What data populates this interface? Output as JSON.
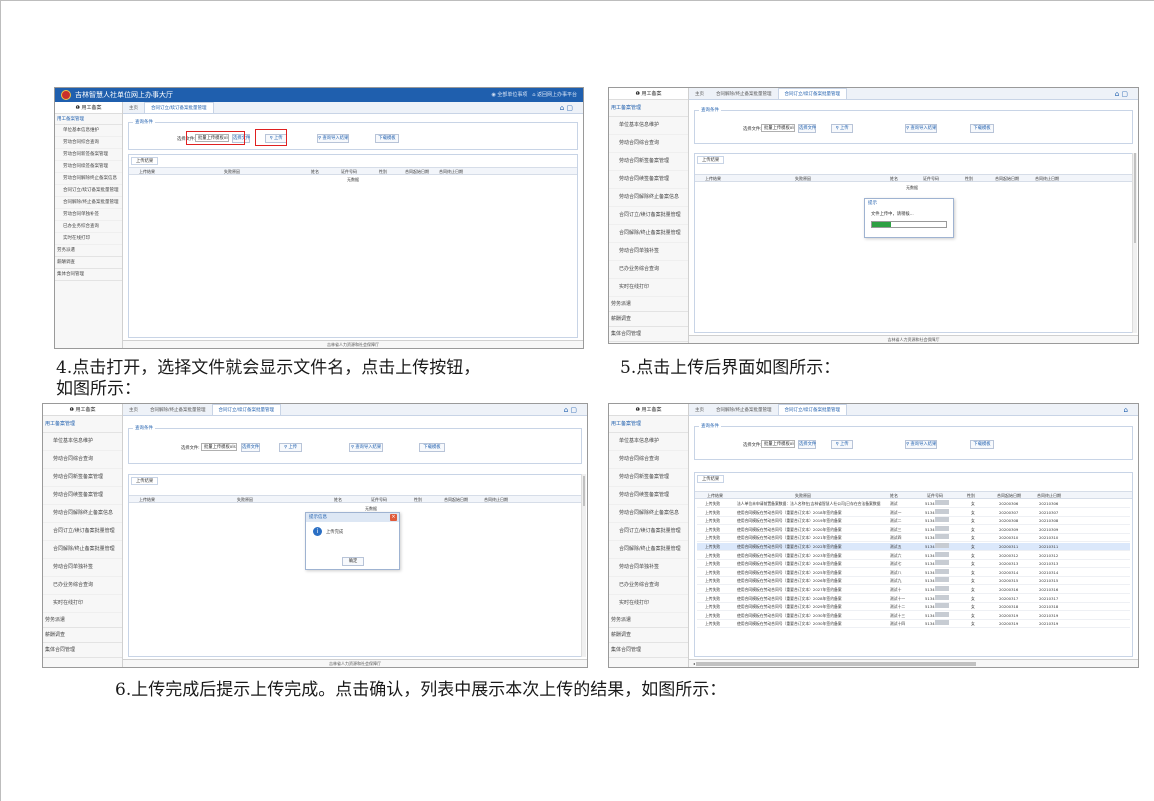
{
  "captions": {
    "step4_line1": "4.点击打开，选择文件就会显示文件名，点击上传按钮，",
    "step4_line2": "如图所示：",
    "step5": "5.点击上传后界面如图所示：",
    "step6": "6.上传完成后提示上传完成。点击确认，列表中展示本次上传的结果，如图所示："
  },
  "app": {
    "title": "吉林智慧人社单位网上办事大厅",
    "top_right_user": "全部单位事项",
    "top_right_home": "返回网上办事平台",
    "side_head": "用工备案",
    "footer": "吉林省人力资源和社会保障厅"
  },
  "sidebar": {
    "group_open": "用工备案管理",
    "items": [
      "单位基本信息维护",
      "劳动合同综合查询",
      "劳动合同新签备案管理",
      "劳动合同续签备案管理",
      "劳动合同解除终止备案信息",
      "合同订立/续订备案批量管理",
      "合同解除/终止备案批量管理",
      "劳动合同单独补签",
      "已办业务综合查询",
      "实时在线打印"
    ],
    "tails": [
      "劳务派遣",
      "薪酬调查",
      "集体合同管理"
    ]
  },
  "tabs": [
    "主页",
    "合同解除/终止备案批量管理",
    "合同订立/续订备案批量管理"
  ],
  "conditions": {
    "label": "查询条件",
    "file_label": "选择文件:",
    "file_value": "批量上传模板xls.xls",
    "choose_button": "选择文件",
    "upload_button": "上传",
    "view_result_button": "查询导入结果",
    "download_template_button": "下载模板"
  },
  "results": {
    "tab": "上传结果",
    "columns": [
      "上传结果",
      "失败原因",
      "姓名",
      "证件号码",
      "性别",
      "合同起始日期",
      "合同终止日期"
    ],
    "no_data": "无数据"
  },
  "progress_dialog": {
    "title": "提示",
    "message": "文件上传中，请稍候...",
    "percent": 0.25
  },
  "done_dialog": {
    "title": "提示信息",
    "message": "上传完成",
    "ok_button": "确定"
  },
  "upload_rows": [
    {
      "result": "上传失败",
      "reason": "法人单位未申请前置备案数据：法人名称在[吉林省智慧人社公司]已存在合法备案数据",
      "name": "测试",
      "id": "5134",
      "gender": "女",
      "start": "20200306",
      "end": "20210306"
    },
    {
      "result": "上传失败",
      "reason": "使用合同模板在劳动合同号（重要合订文本）2018年签约备案",
      "name": "测试一",
      "id": "5134",
      "gender": "女",
      "start": "20200307",
      "end": "20210307"
    },
    {
      "result": "上传失败",
      "reason": "使用合同模板在劳动合同号（重要合订文本）2019年签约备案",
      "name": "测试二",
      "id": "5134",
      "gender": "女",
      "start": "20200308",
      "end": "20210308"
    },
    {
      "result": "上传失败",
      "reason": "使用合同模板在劳动合同号（重要合订文本）2020年签约备案",
      "name": "测试三",
      "id": "5134",
      "gender": "女",
      "start": "20200309",
      "end": "20210309"
    },
    {
      "result": "上传失败",
      "reason": "使用合同模板在劳动合同号（重要合订文本）2021年签约备案",
      "name": "测试四",
      "id": "5134",
      "gender": "女",
      "start": "20200310",
      "end": "20210310"
    },
    {
      "result": "上传失败",
      "reason": "使用合同模板在劳动合同号（重要合订文本）2022年签约备案",
      "name": "测试五",
      "id": "5134",
      "gender": "女",
      "start": "20200311",
      "end": "20210311"
    },
    {
      "result": "上传失败",
      "reason": "使用合同模板在劳动合同号（重要合订文本）2023年签约备案",
      "name": "测试六",
      "id": "5134",
      "gender": "女",
      "start": "20200312",
      "end": "20210312"
    },
    {
      "result": "上传失败",
      "reason": "使用合同模板在劳动合同号（重要合订文本）2024年签约备案",
      "name": "测试七",
      "id": "5134",
      "gender": "女",
      "start": "20200313",
      "end": "20210313"
    },
    {
      "result": "上传失败",
      "reason": "使用合同模板在劳动合同号（重要合订文本）2025年签约备案",
      "name": "测试八",
      "id": "5134",
      "gender": "女",
      "start": "20200314",
      "end": "20210314"
    },
    {
      "result": "上传失败",
      "reason": "使用合同模板在劳动合同号（重要合订文本）2026年签约备案",
      "name": "测试九",
      "id": "5134",
      "gender": "女",
      "start": "20200315",
      "end": "20210315"
    },
    {
      "result": "上传失败",
      "reason": "使用合同模板在劳动合同号（重要合订文本）2027年签约备案",
      "name": "测试十",
      "id": "5134",
      "gender": "女",
      "start": "20200316",
      "end": "20210316"
    },
    {
      "result": "上传失败",
      "reason": "使用合同模板在劳动合同号（重要合订文本）2028年签约备案",
      "name": "测试十一",
      "id": "5134",
      "gender": "女",
      "start": "20200317",
      "end": "20210317"
    },
    {
      "result": "上传失败",
      "reason": "使用合同模板在劳动合同号（重要合订文本）2029年签约备案",
      "name": "测试十二",
      "id": "5134",
      "gender": "女",
      "start": "20200318",
      "end": "20210318"
    },
    {
      "result": "上传失败",
      "reason": "使用合同模板在劳动合同号（重要合订文本）2030年签约备案",
      "name": "测试十三",
      "id": "5134",
      "gender": "女",
      "start": "20200319",
      "end": "20210319"
    },
    {
      "result": "上传失败",
      "reason": "使用合同模板在劳动合同号（重要合订文本）2030年签约备案",
      "name": "测试十四",
      "id": "5134",
      "gender": "女",
      "start": "20200319",
      "end": "20210319"
    }
  ],
  "colors": {
    "brand": "#1f5fae",
    "highlight": "#e02020",
    "progress": "#2ea043"
  }
}
